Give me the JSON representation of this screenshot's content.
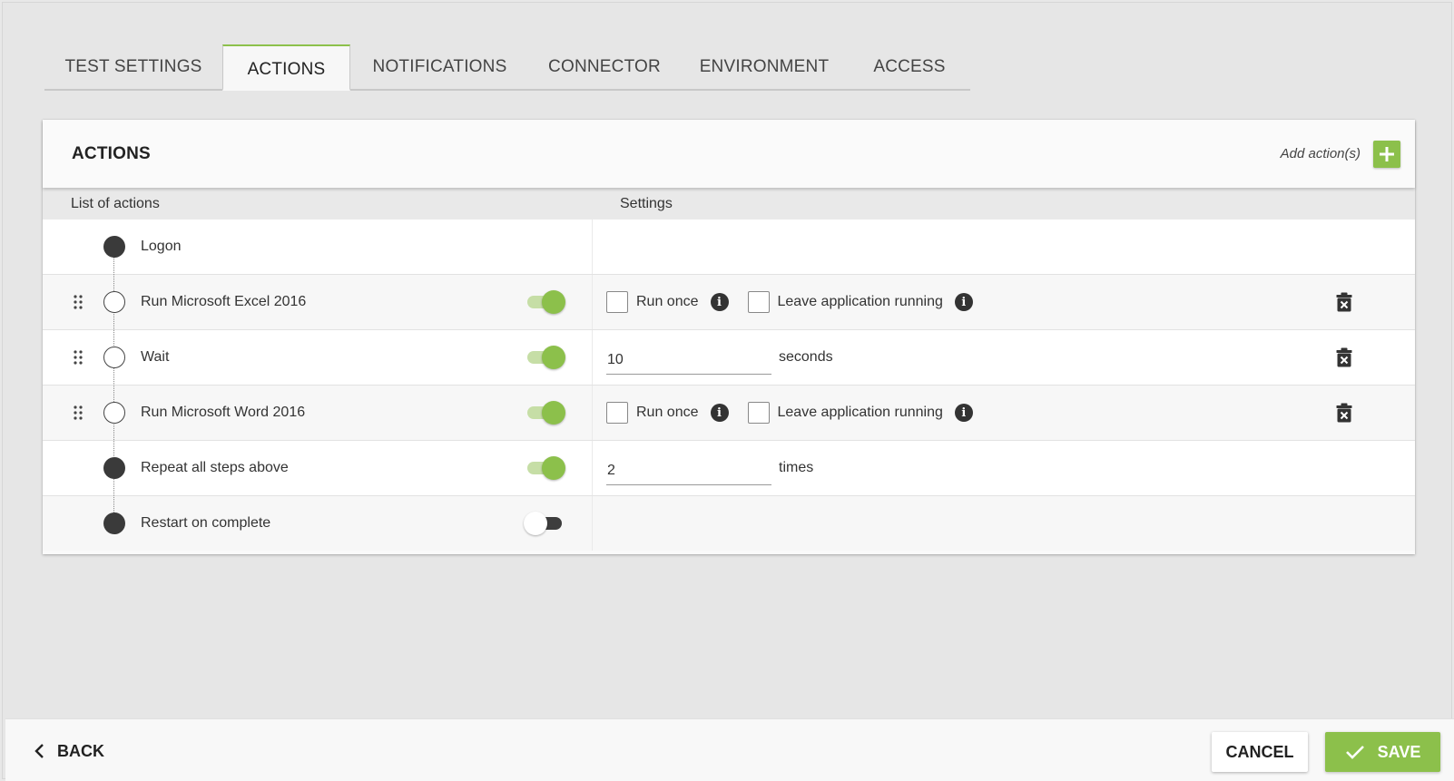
{
  "tabs": [
    {
      "label": "TEST SETTINGS",
      "active": false
    },
    {
      "label": "ACTIONS",
      "active": true
    },
    {
      "label": "NOTIFICATIONS",
      "active": false
    },
    {
      "label": "CONNECTOR",
      "active": false
    },
    {
      "label": "ENVIRONMENT",
      "active": false
    },
    {
      "label": "ACCESS",
      "active": false
    }
  ],
  "panel": {
    "title": "ACTIONS",
    "add_label": "Add action(s)",
    "col_actions": "List of actions",
    "col_settings": "Settings"
  },
  "actions": [
    {
      "label": "Logon",
      "node": "filled"
    },
    {
      "label": "Run Microsoft Excel 2016",
      "node": "hollow",
      "enabled": true,
      "run_once_label": "Run once",
      "leave_running_label": "Leave application running"
    },
    {
      "label": "Wait",
      "node": "hollow",
      "enabled": true,
      "value": "10",
      "unit": "seconds"
    },
    {
      "label": "Run Microsoft Word 2016",
      "node": "hollow",
      "enabled": true,
      "run_once_label": "Run once",
      "leave_running_label": "Leave application running"
    },
    {
      "label": "Repeat all steps above",
      "node": "filled",
      "enabled": true,
      "value": "2",
      "unit": "times"
    },
    {
      "label": "Restart on complete",
      "node": "filled",
      "enabled": false
    }
  ],
  "footer": {
    "back_label": "BACK",
    "cancel_label": "CANCEL",
    "save_label": "SAVE"
  },
  "colors": {
    "accent": "#8cc04b",
    "accent_light": "#c6dea6",
    "dark": "#3a3a3a"
  }
}
